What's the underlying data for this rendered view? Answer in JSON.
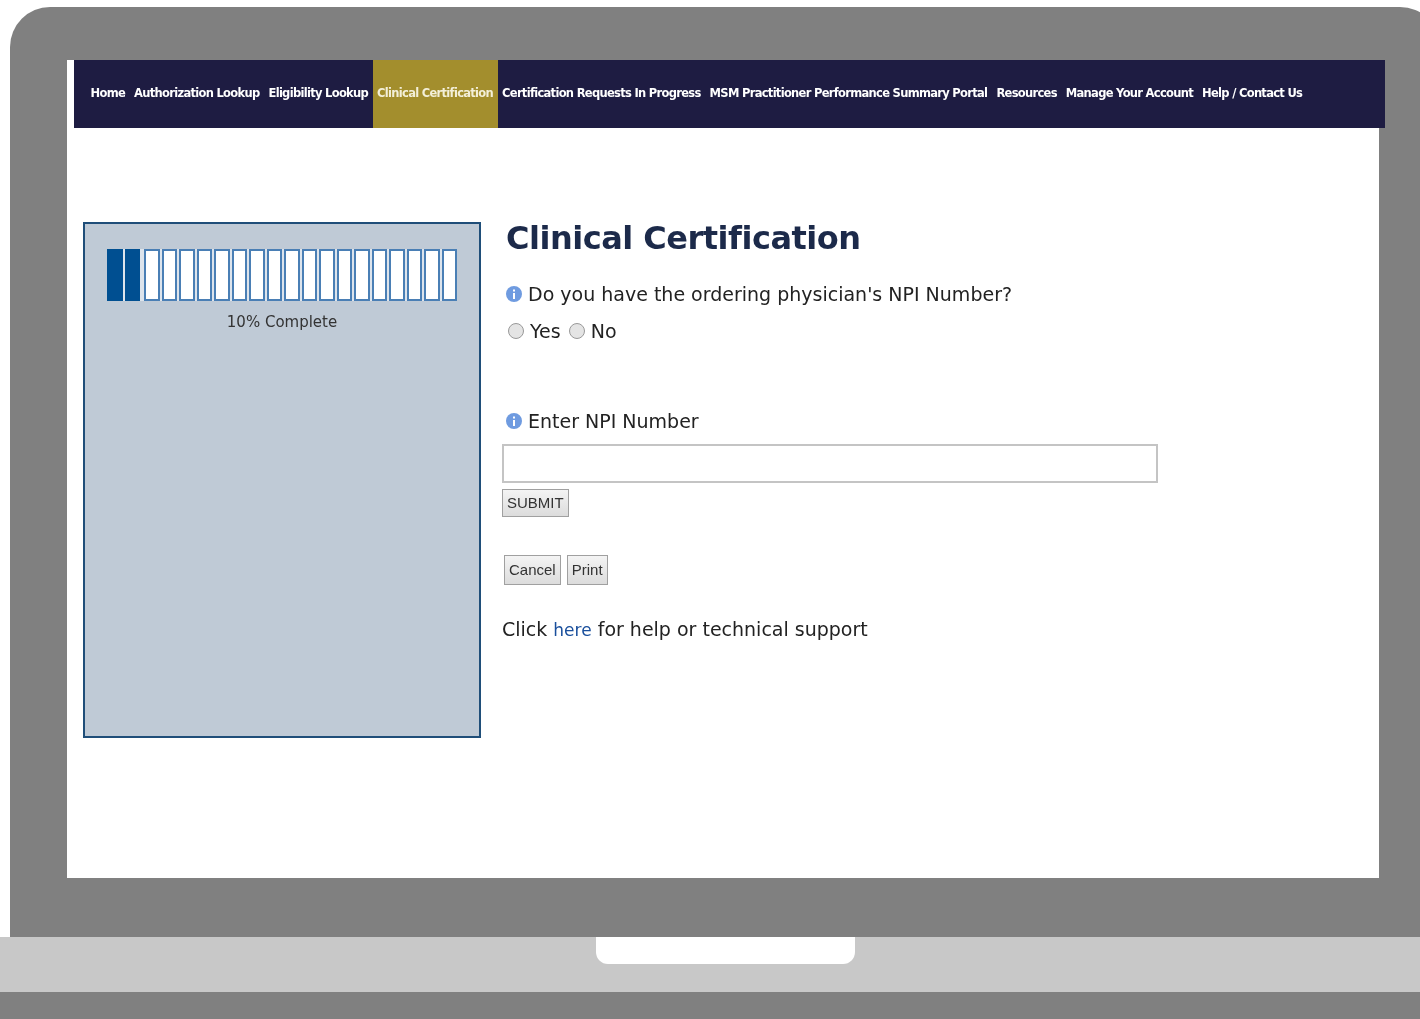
{
  "nav": [
    {
      "label": "Home",
      "selected": false
    },
    {
      "label": "Authorization Lookup",
      "selected": false
    },
    {
      "label": "Eligibility Lookup",
      "selected": false
    },
    {
      "label": "Clinical Certification",
      "selected": true
    },
    {
      "label": "Certification Requests In Progress",
      "selected": false
    },
    {
      "label": "MSM Practitioner Performance Summary Portal",
      "selected": false
    },
    {
      "label": "Resources",
      "selected": false
    },
    {
      "label": "Manage Your Account",
      "selected": false
    },
    {
      "label": "Help / Contact Us",
      "selected": false
    }
  ],
  "progress": {
    "level": 0.1,
    "label": "10% Complete"
  },
  "title": "Clinical Certification",
  "question": {
    "label": "Do you have the ordering physician's NPI Number?",
    "options": [
      {
        "label": "Yes",
        "selected": false
      },
      {
        "label": "No",
        "selected": false
      }
    ]
  },
  "npi_field": {
    "label": "Enter NPI Number"
  },
  "submit": "SUBMIT",
  "buttons": [
    "Cancel",
    "Print"
  ],
  "help": {
    "before": "Click",
    "link": "here",
    "after": "for help or technical support"
  }
}
